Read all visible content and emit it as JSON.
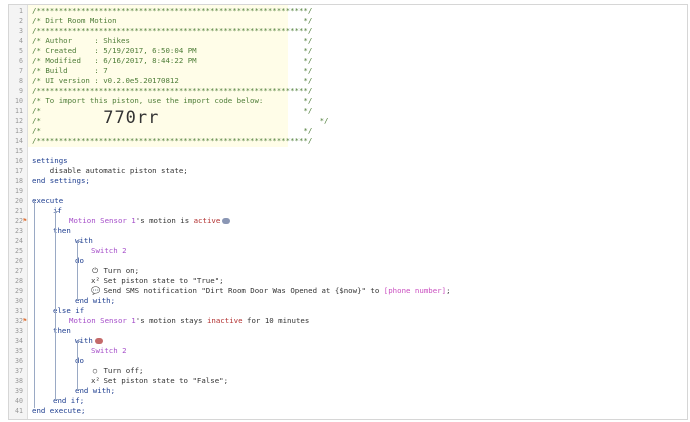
{
  "lines": [
    {
      "n": "1",
      "t": "/*************************************************************/"
    },
    {
      "n": "2",
      "t": "/* Dirt Room Motion                                          */"
    },
    {
      "n": "3",
      "t": "/*************************************************************/"
    },
    {
      "n": "4",
      "t": "/* Author     : Shikes                                       */"
    },
    {
      "n": "5",
      "t": "/* Created    : 5/19/2017, 6:50:04 PM                        */"
    },
    {
      "n": "6",
      "t": "/* Modified   : 6/16/2017, 8:44:22 PM                        */"
    },
    {
      "n": "7",
      "t": "/* Build      : 7                                            */"
    },
    {
      "n": "8",
      "t": "/* UI version : v0.2.0e5.20170812                            */"
    },
    {
      "n": "9",
      "t": "/*************************************************************/"
    },
    {
      "n": "10",
      "t": "/* To import this piston, use the import code below:         */"
    },
    {
      "n": "11",
      "t": "/*                                                           */"
    },
    {
      "n": "12",
      "t": "/*              ",
      "code": "770rr",
      "t2": "                                    */"
    },
    {
      "n": "13",
      "t": "/*                                                           */"
    },
    {
      "n": "14",
      "t": "/*************************************************************/"
    },
    {
      "n": "15",
      "t": ""
    },
    {
      "n": "16",
      "kw": "settings"
    },
    {
      "n": "17",
      "t": "    disable automatic piston state;"
    },
    {
      "n": "18",
      "kw": "end settings;"
    },
    {
      "n": "19",
      "t": ""
    },
    {
      "n": "20",
      "kw": "execute"
    },
    {
      "n": "21",
      "kw": "if"
    },
    {
      "n": "22",
      "dev": "Motion Sensor 1",
      "mid": "'s motion is ",
      "val": "active"
    },
    {
      "n": "23",
      "kw": "then"
    },
    {
      "n": "24",
      "kw": "with"
    },
    {
      "n": "25",
      "dev": "Switch 2"
    },
    {
      "n": "26",
      "kw": "do"
    },
    {
      "n": "27",
      "t": "Turn on;"
    },
    {
      "n": "28",
      "t": "Set piston state to \"True\";"
    },
    {
      "n": "29",
      "t": "Send SMS notification \"Dirt Room Door Was Opened at {$now}\" to ",
      "var": "[phone number]",
      "t2": ";"
    },
    {
      "n": "30",
      "kw": "end with;"
    },
    {
      "n": "31",
      "kw": "else if"
    },
    {
      "n": "32",
      "dev": "Motion Sensor 1",
      "mid": "'s motion stays ",
      "val": "inactive",
      "mid2": " for ",
      "num": "10 minutes"
    },
    {
      "n": "33",
      "kw": "then"
    },
    {
      "n": "34",
      "kw": "with"
    },
    {
      "n": "35",
      "dev": "Switch 2"
    },
    {
      "n": "36",
      "kw": "do"
    },
    {
      "n": "37",
      "t": "Turn off;"
    },
    {
      "n": "38",
      "t": "Set piston state to \"False\";"
    },
    {
      "n": "39",
      "kw": "end with;"
    },
    {
      "n": "40",
      "kw": "end if;"
    },
    {
      "n": "41",
      "kw": "end execute;"
    }
  ],
  "icons": {
    "power_on": "⏻",
    "power_off": "○",
    "variable": "x²",
    "sms": "💬",
    "marker": "⚑"
  }
}
